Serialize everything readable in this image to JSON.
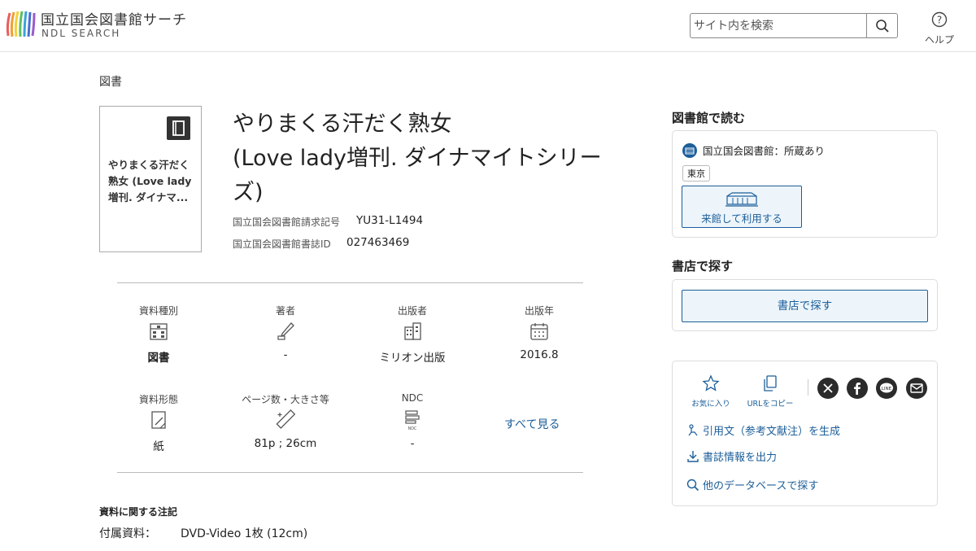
{
  "header": {
    "logo_jp": "国立国会図書館サーチ",
    "logo_en": "NDL SEARCH",
    "search_placeholder": "サイト内を検索",
    "help_label": "ヘルプ"
  },
  "breadcrumb": "図書",
  "cover": {
    "title": "やりまくる汗だく熟女 (Love lady増刊. ダイナマ..."
  },
  "book": {
    "title_line1": "やりまくる汗だく熟女",
    "title_line2": "(Love lady増刊. ダイナマイトシリー",
    "title_line3": "ズ)",
    "call_number_label": "国立国会図書館請求記号",
    "call_number": "YU31-L1494",
    "biblio_id_label": "国立国会図書館書誌ID",
    "biblio_id": "027463469"
  },
  "details": [
    {
      "label": "資料種別",
      "icon": "building-icon",
      "value": "図書"
    },
    {
      "label": "著者",
      "icon": "pen-icon",
      "value": "-"
    },
    {
      "label": "出版者",
      "icon": "office-building-icon",
      "value": "ミリオン出版"
    },
    {
      "label": "出版年",
      "icon": "calendar-icon",
      "value": "2016.8"
    },
    {
      "label": "資料形態",
      "icon": "document-icon",
      "value": "紙"
    },
    {
      "label": "ページ数・大きさ等",
      "icon": "ruler-icon",
      "value": "81p ; 26cm"
    },
    {
      "label": "NDC",
      "icon": "ndc-icon",
      "value": "-"
    }
  ],
  "see_all": "すべて見る",
  "notes": {
    "heading": "資料に関する注記",
    "key": "付属資料：",
    "value": "DVD-Video 1枚 (12cm)"
  },
  "sidebar": {
    "read_heading": "図書館で読む",
    "library_name": "国立国会図書館：所蔵あり",
    "location_tag": "東京",
    "visit_button": "来館して利用する",
    "shop_heading": "書店で探す",
    "shop_button": "書店で探す",
    "favorite_label": "お気に入り",
    "copy_url_label": "URLをコピー",
    "cite_link": "引用文（参考文献注）を生成",
    "export_link": "書誌情報を出力",
    "other_db_link": "他のデータベースで探す"
  },
  "colors": {
    "accent": "#1c5e99",
    "button_bg": "#edf5fb"
  }
}
